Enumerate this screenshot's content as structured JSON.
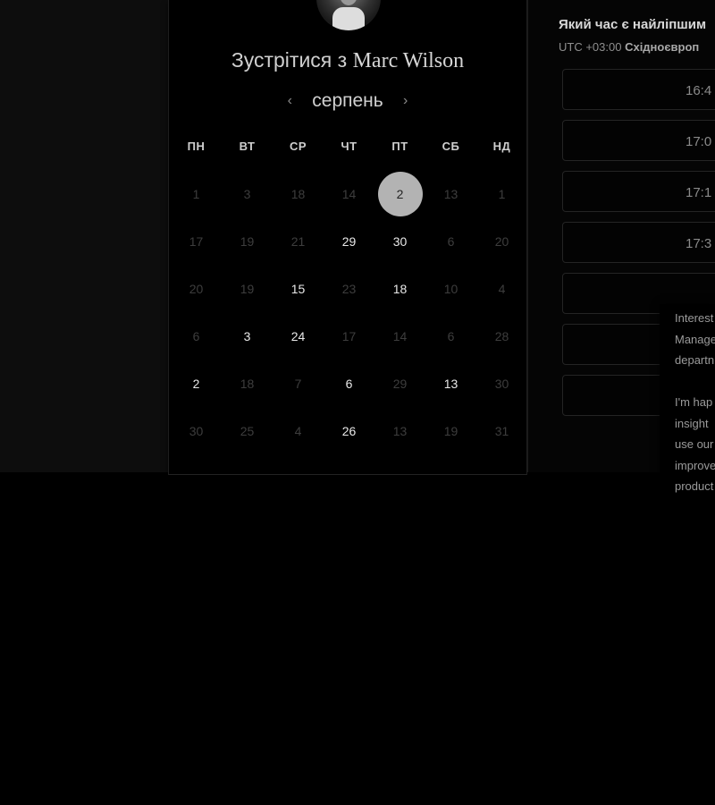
{
  "meeting": {
    "title_prefix": "Зустрітися з",
    "host": "Marc Wilson",
    "month": "серпень"
  },
  "weekdays": [
    "ПН",
    "ВТ",
    "СР",
    "ЧТ",
    "ПТ",
    "СБ",
    "НД"
  ],
  "days": [
    {
      "label": "1",
      "state": "muted"
    },
    {
      "label": "3",
      "state": "muted"
    },
    {
      "label": "18",
      "state": "muted"
    },
    {
      "label": "14",
      "state": "muted"
    },
    {
      "label": "2",
      "state": "selected"
    },
    {
      "label": "13",
      "state": "muted"
    },
    {
      "label": "1",
      "state": "muted"
    },
    {
      "label": "17",
      "state": "muted"
    },
    {
      "label": "19",
      "state": "muted"
    },
    {
      "label": "21",
      "state": "muted"
    },
    {
      "label": "29",
      "state": "avail"
    },
    {
      "label": "30",
      "state": "avail"
    },
    {
      "label": "6",
      "state": "muted"
    },
    {
      "label": "20",
      "state": "muted"
    },
    {
      "label": "20",
      "state": "muted"
    },
    {
      "label": "19",
      "state": "muted"
    },
    {
      "label": "15",
      "state": "avail"
    },
    {
      "label": "23",
      "state": "muted"
    },
    {
      "label": "18",
      "state": "avail"
    },
    {
      "label": "10",
      "state": "muted"
    },
    {
      "label": "4",
      "state": "muted"
    },
    {
      "label": "6",
      "state": "muted"
    },
    {
      "label": "3",
      "state": "avail"
    },
    {
      "label": "24",
      "state": "avail"
    },
    {
      "label": "17",
      "state": "muted"
    },
    {
      "label": "14",
      "state": "muted"
    },
    {
      "label": "6",
      "state": "muted"
    },
    {
      "label": "28",
      "state": "muted"
    },
    {
      "label": "2",
      "state": "avail"
    },
    {
      "label": "18",
      "state": "muted"
    },
    {
      "label": "7",
      "state": "muted"
    },
    {
      "label": "6",
      "state": "avail"
    },
    {
      "label": "29",
      "state": "muted"
    },
    {
      "label": "13",
      "state": "avail"
    },
    {
      "label": "30",
      "state": "muted"
    },
    {
      "label": "30",
      "state": "muted"
    },
    {
      "label": "25",
      "state": "muted"
    },
    {
      "label": "4",
      "state": "muted"
    },
    {
      "label": "26",
      "state": "avail"
    },
    {
      "label": "13",
      "state": "muted"
    },
    {
      "label": "19",
      "state": "muted"
    },
    {
      "label": "31",
      "state": "muted"
    }
  ],
  "schedule": {
    "question": "Який час є найліпшим",
    "tz_offset": "UTC +03:00",
    "tz_name": "Східноєвроп",
    "slots": [
      "16:4",
      "17:0",
      "17:1",
      "17:3",
      "",
      "",
      ""
    ]
  },
  "tooltip": {
    "text": "Interest\nManage\ndepartn\n\nI'm hap\ninsight\nuse our\nimprove\nproduct"
  },
  "icons": {
    "prev": "chevron-left-icon",
    "next": "chevron-right-icon"
  }
}
